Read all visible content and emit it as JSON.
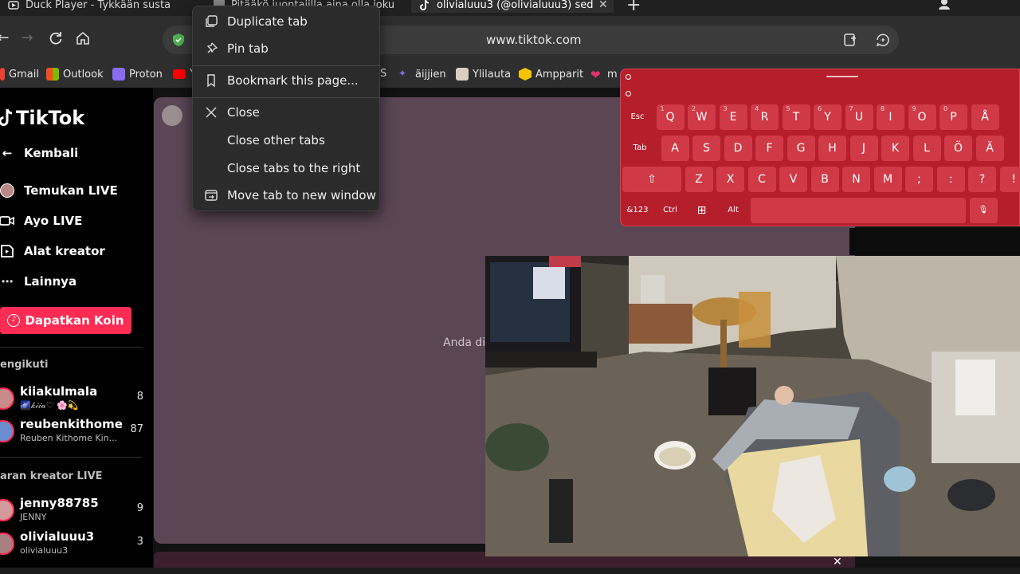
{
  "tabs": [
    {
      "title": "Duck Player - Tykkään susta"
    },
    {
      "title": "Pitääkö juontajilla aina olla joku"
    },
    {
      "title": "olivialuuu3 (@olivialuuu3) sed"
    }
  ],
  "address": {
    "url": "www.tiktok.com"
  },
  "bookmarks": [
    "Gmail",
    "Outlook",
    "Proton",
    "Y",
    "S",
    "äijjien",
    "Ylilauta",
    "Ampparit",
    "m"
  ],
  "context_menu": {
    "items": [
      "Duplicate tab",
      "Pin tab",
      "Bookmark this page...",
      "Close",
      "Close other tabs",
      "Close tabs to the right",
      "Move tab to new window"
    ]
  },
  "tiktok": {
    "logo": "TikTok",
    "nav": [
      "Kembali",
      "Temukan LIVE",
      "Ayo LIVE",
      "Alat kreator",
      "Lainnya"
    ],
    "coin_button": "Dapatkan Koin",
    "following_header": "engikuti",
    "following": [
      {
        "name": "kiiakulmala",
        "sub": "🌌𝓀𝒾𝒾𝒶♡ 🌸💫",
        "count": "8"
      },
      {
        "name": "reubenkithome",
        "sub": "Reuben Kithome Kin...",
        "count": "87"
      }
    ],
    "suggested_header": "aran kreator LIVE",
    "suggested": [
      {
        "name": "jenny88785",
        "sub": "JENNY",
        "count": "9"
      },
      {
        "name": "olivialuuu3",
        "sub": "olivialuuu3",
        "count": "3"
      }
    ],
    "content_text": "Anda dib"
  },
  "keyboard": {
    "row1": [
      "Esc",
      "Q",
      "W",
      "E",
      "R",
      "T",
      "Y",
      "U",
      "I",
      "O",
      "P",
      "Å"
    ],
    "row1_alt": [
      "",
      "1",
      "2",
      "3",
      "4",
      "5",
      "6",
      "7",
      "8",
      "9",
      "0",
      ""
    ],
    "row2": [
      "Tab",
      "A",
      "S",
      "D",
      "F",
      "G",
      "H",
      "J",
      "K",
      "L",
      "Ö",
      "Ä"
    ],
    "row3": [
      "⇧",
      "Z",
      "X",
      "C",
      "V",
      "B",
      "N",
      "M",
      ";",
      ":",
      "?",
      "!"
    ],
    "row4": [
      "&123",
      "Ctrl",
      "⊞",
      "Alt",
      "",
      "🎙"
    ]
  },
  "colors": {
    "tiktok_pink": "#fe2c55",
    "keyboard_red": "#b51f2c"
  }
}
